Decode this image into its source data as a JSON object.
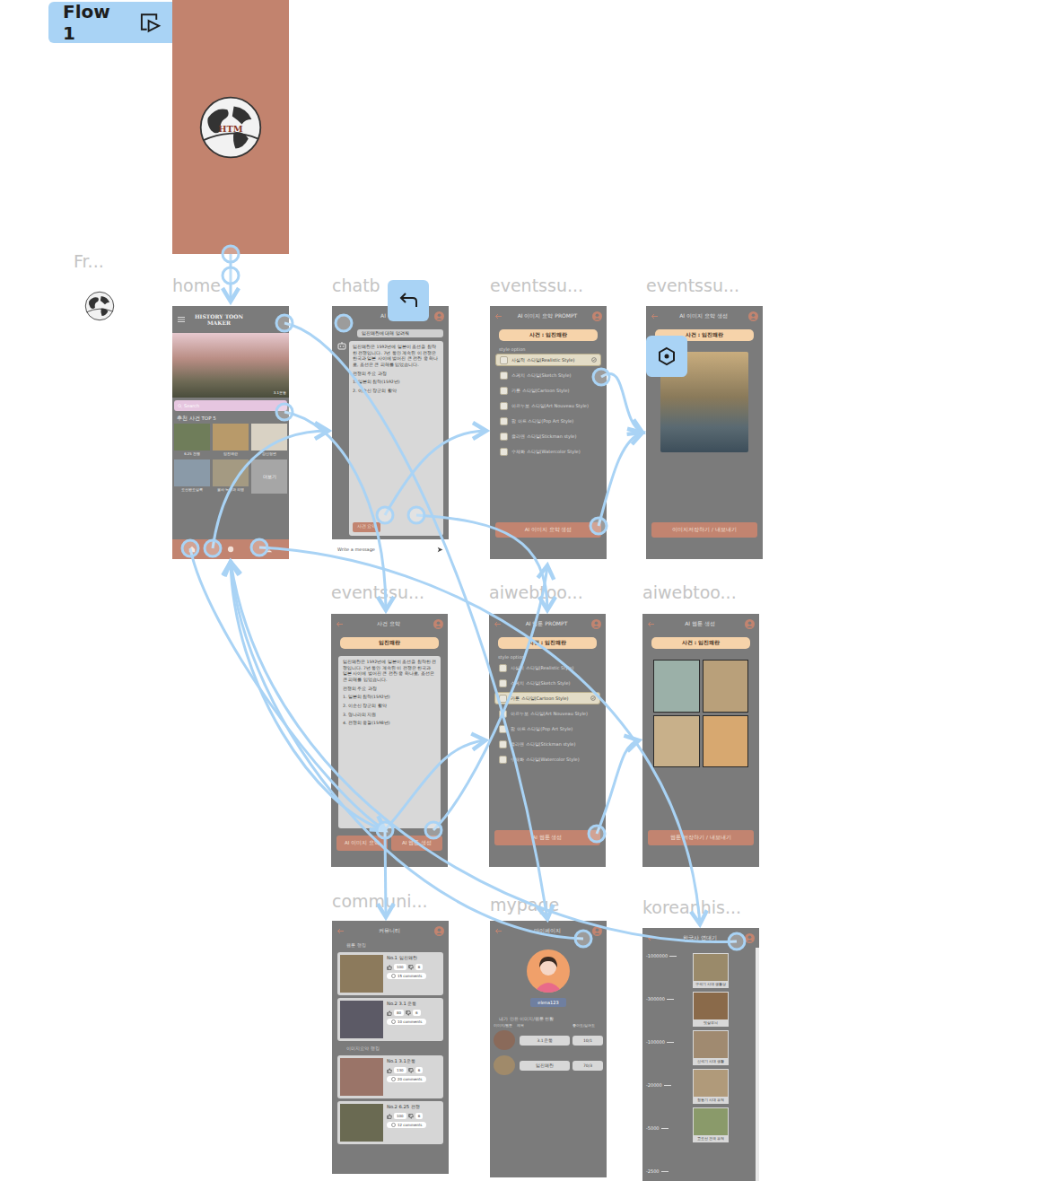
{
  "flow": {
    "label": "Flow 1"
  },
  "orphan": {
    "label": "Fr..."
  },
  "splash": {
    "logo": "HTM"
  },
  "home": {
    "label": "home",
    "title": "HISTORY TOON MAKER",
    "hero_caption": "3.1운동",
    "search": {
      "placeholder": "Search"
    },
    "section": "추천 사건 TOP 5",
    "tiles": [
      {
        "caption": "6.25 전쟁",
        "color": "#6f7d5a"
      },
      {
        "caption": "임진왜란",
        "color": "#b89a6a"
      },
      {
        "caption": "갑신정변",
        "color": "#d9d2c4"
      },
      {
        "caption": "조선왕조실록",
        "color": "#8a9aa8"
      },
      {
        "caption": "을사 늑약과 의병",
        "color": "#a49a82"
      }
    ],
    "more": "더보기"
  },
  "chatbot": {
    "label": "chatb",
    "title": "AI 챗봇",
    "user_message": "임진왜란에 대해 알려줘",
    "bot_message": "임진왜란은 1592년에 일본이 조선을 침략한 전쟁입니다. 7년 동안 계속된 이 전쟁은 한국과 일본 사이에 벌어진 큰 전란 중 하나로, 조선은 큰 피해를 입었습니다.",
    "bot_points": [
      "전쟁의 주요 과정",
      "1. 일본의 침략(1592년)",
      "2. 이순신 장군의 활약"
    ],
    "action": "사건 요약",
    "input_placeholder": "Write a message"
  },
  "image_prompt": {
    "label": "eventssu...",
    "title": "AI 이미지 요약 PROMPT",
    "event": "사건 : 임진왜란",
    "options_label": "style option",
    "options": [
      {
        "text": "사실적 스타일(Realistic Style)",
        "selected": true
      },
      {
        "text": "스케치 스타일(Sketch Style)",
        "selected": false
      },
      {
        "text": "카툰 스타일(Cartoon Style)",
        "selected": false
      },
      {
        "text": "아르누보 스타일(Art Nouveau Style)",
        "selected": false
      },
      {
        "text": "팝 아트 스타일(Pop Art Style)",
        "selected": false
      },
      {
        "text": "졸라맨 스타일(Stickman style)",
        "selected": false
      },
      {
        "text": "수채화 스타일(Watercolor Style)",
        "selected": false
      }
    ],
    "button": "AI 이미지 요약 생성"
  },
  "image_result": {
    "label": "eventssu...",
    "title": "AI 이미지 요약 생성",
    "event": "사건 : 임진왜란",
    "button": "이미지저장하기 / 내보내기"
  },
  "summary": {
    "label": "eventssu...",
    "title": "사건 요약",
    "event": "임진왜란",
    "body": "임진왜란은 1592년에 일본이 조선을 침략한 전쟁입니다. 7년 동안 계속된 이 전쟁은 한국과 일본 사이에 벌어진 큰 전란 중 하나로, 조선은 큰 피해를 입었습니다.",
    "points": [
      "전쟁의 주요 과정",
      "1. 일본의 침략(1592년)",
      "2. 이순신 장군의 활약",
      "3. 명나라의 지원",
      "4. 전쟁의 종결(1598년)"
    ],
    "buttons": [
      "AI 이미지 요약",
      "AI 웹툰 생성"
    ]
  },
  "webtoon_prompt": {
    "label": "aiwebtoo...",
    "title": "AI 웹툰 PROMPT",
    "event": "사건 : 임진왜란",
    "options_label": "style option",
    "options": [
      {
        "text": "사실적 스타일(Realistic Style)",
        "selected": false
      },
      {
        "text": "스케치 스타일(Sketch Style)",
        "selected": false
      },
      {
        "text": "카툰 스타일(Cartoon Style)",
        "selected": true
      },
      {
        "text": "아르누보 스타일(Art Nouveau Style)",
        "selected": false
      },
      {
        "text": "팝 아트 스타일(Pop Art Style)",
        "selected": false
      },
      {
        "text": "졸라맨 스타일(Stickman style)",
        "selected": false
      },
      {
        "text": "수채화 스타일(Watercolor Style)",
        "selected": false
      }
    ],
    "button": "AI 웹툰 생성"
  },
  "webtoon_result": {
    "label": "aiwebtoo...",
    "title": "AI 웹툰 생성",
    "event": "사건 : 임진왜란",
    "button": "웹툰 저장하기 / 내보내기"
  },
  "community": {
    "label": "communi...",
    "title": "커뮤니티",
    "sections": [
      {
        "heading": "웹툰 랭킹",
        "items": [
          {
            "title": "No.1 임진왜란",
            "likes": "100",
            "dislikes": "6",
            "comments": "15 comments",
            "color": "#8c7a5c"
          },
          {
            "title": "No.2 3.1 운동",
            "likes": "80",
            "dislikes": "6",
            "comments": "10 comments",
            "color": "#5c5a66"
          }
        ]
      },
      {
        "heading": "이미지요약 랭킹",
        "items": [
          {
            "title": "No.1 3.1운동",
            "likes": "130",
            "dislikes": "6",
            "comments": "20 comments",
            "color": "#9a7468"
          },
          {
            "title": "No.2 6.25 전쟁",
            "likes": "100",
            "dislikes": "6",
            "comments": "12 comments",
            "color": "#6a6a52"
          }
        ]
      }
    ]
  },
  "mypage": {
    "label": "mypage",
    "title": "마이페이지",
    "username": "elena123",
    "section": "내가 만든 이미지/웹툰 현황",
    "columns": [
      "이미지/웹툰",
      "제목",
      "좋아요/싫어요"
    ],
    "rows": [
      {
        "title": "3.1운동",
        "score": "10/1",
        "color": "#8a6a5a"
      },
      {
        "title": "임진왜란",
        "score": "70/3",
        "color": "#a08a6a"
      }
    ]
  },
  "korean_history": {
    "label": "koreanhis...",
    "title": "한국사 연대기",
    "ticks": [
      "-1000000",
      "-300000",
      "-100000",
      "-20000",
      "-5000",
      "-2500"
    ],
    "items": [
      {
        "caption": "구석기 시대 생활상",
        "color": "#9a8a6a"
      },
      {
        "caption": "빗살무늬",
        "color": "#8a6a4a"
      },
      {
        "caption": "신석기 시대 생활",
        "color": "#a08a70"
      },
      {
        "caption": "청동기 시대 유적",
        "color": "#b09a7a"
      },
      {
        "caption": "고조선 건국 유적",
        "color": "#8a9a6a"
      }
    ]
  }
}
